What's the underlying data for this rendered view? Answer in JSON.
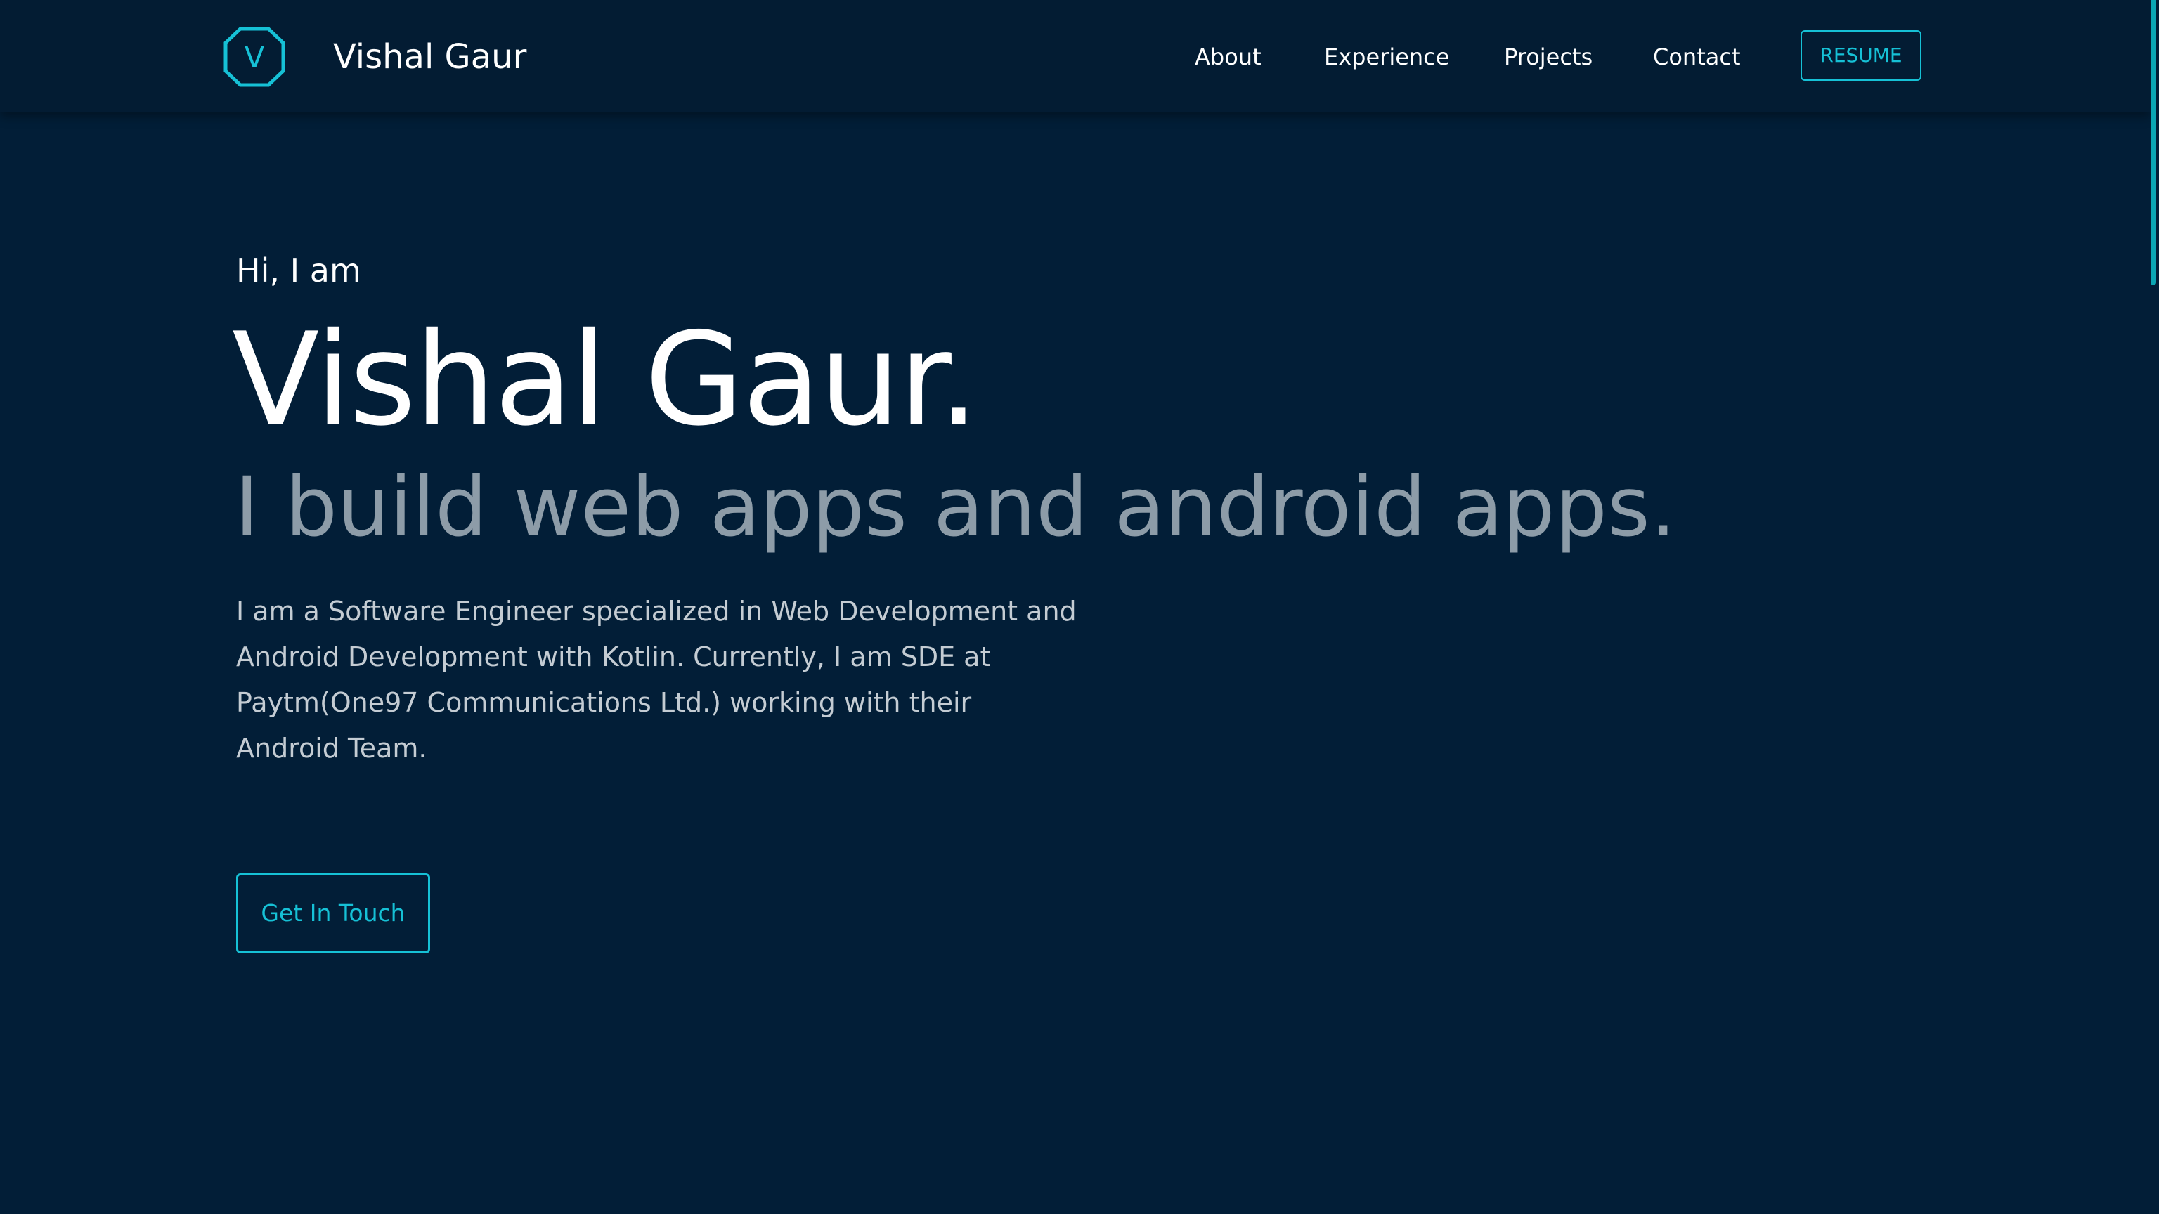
{
  "header": {
    "logo_letter": "V",
    "brand": "Vishal Gaur",
    "nav": {
      "about": "About",
      "experience": "Experience",
      "projects": "Projects",
      "contact": "Contact"
    },
    "resume_label": "RESUME"
  },
  "hero": {
    "greeting": "Hi, I am",
    "name": "Vishal Gaur.",
    "tagline": "I build web apps and android apps.",
    "bio": "I am a Software Engineer specialized in Web Development and Android Development with Kotlin. Currently, I am SDE at Paytm(One97 Communications Ltd.) working with their Android Team.",
    "cta_label": "Get In Touch"
  },
  "colors": {
    "background": "#021e37",
    "nav_background": "#031c33",
    "accent": "#16c1d6",
    "tagline": "#8d9ca8",
    "body_text": "#c4ccd3"
  }
}
